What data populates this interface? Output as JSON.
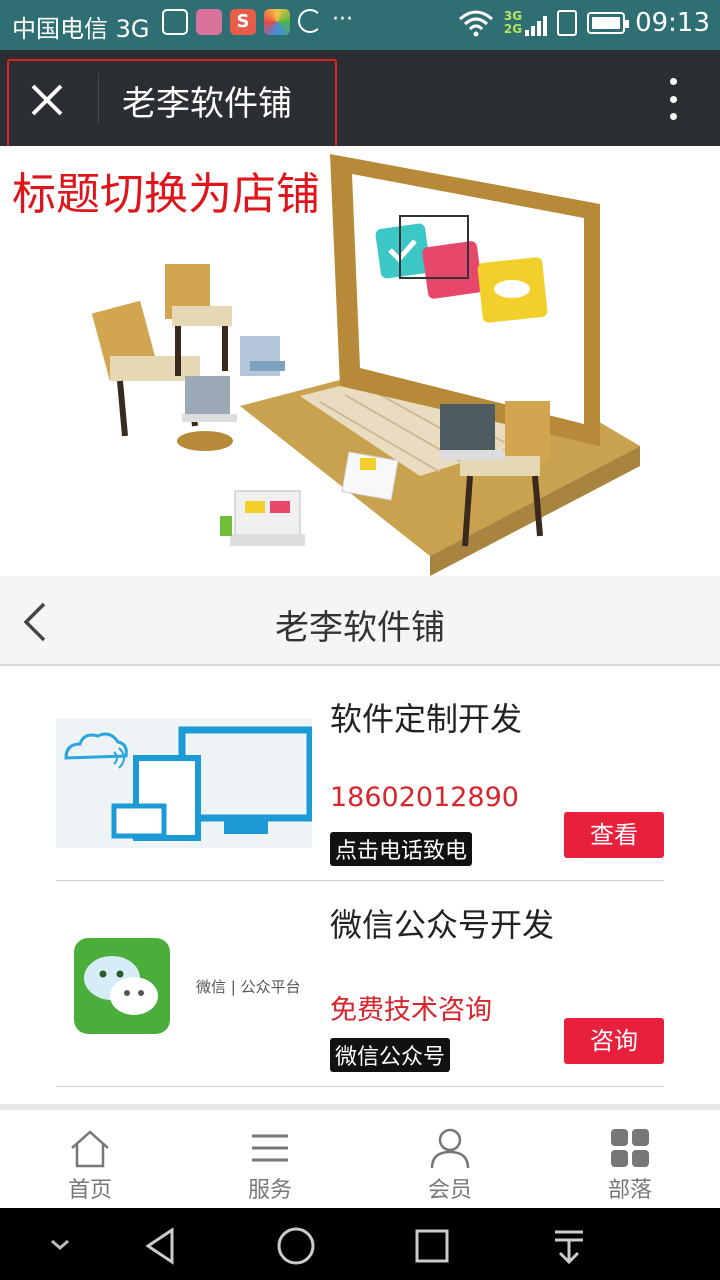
{
  "status_bar": {
    "carrier": "中国电信 3G",
    "network_small": "3G\n2G",
    "time": "09:13",
    "more": "···"
  },
  "app_bar": {
    "title": "老李软件铺"
  },
  "annotation": {
    "text": "标题切换为店铺"
  },
  "nav_bar": {
    "title": "老李软件铺"
  },
  "products": [
    {
      "name": "软件定制开发",
      "highlight": "18602012890",
      "tag": "点击电话致电",
      "button": "查看"
    },
    {
      "name": "微信公众号开发",
      "highlight": "免费技术咨询",
      "tag": "微信公众号",
      "button": "咨询",
      "thumb_text": "微信 | 公众平台"
    }
  ],
  "tab_bar": {
    "items": [
      {
        "label": "首页",
        "icon": "home-icon"
      },
      {
        "label": "服务",
        "icon": "list-icon"
      },
      {
        "label": "会员",
        "icon": "user-icon"
      },
      {
        "label": "部落",
        "icon": "grid-icon"
      }
    ]
  },
  "colors": {
    "status_bar": "#2f6f73",
    "app_bar": "#2b2f33",
    "accent_red": "#e8203c",
    "highlight_red": "#d8242c"
  }
}
